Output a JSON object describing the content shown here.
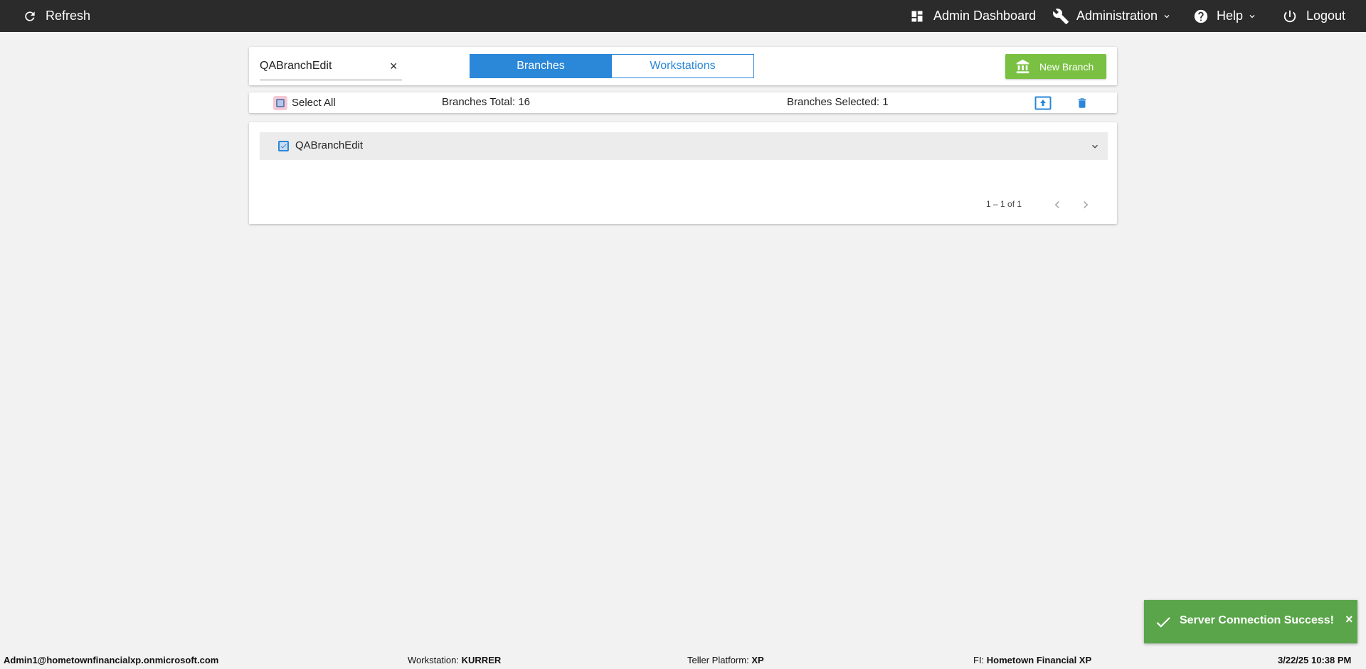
{
  "topbar": {
    "refresh_label": "Refresh",
    "admin_dashboard_label": "Admin Dashboard",
    "administration_label": "Administration",
    "help_label": "Help",
    "logout_label": "Logout"
  },
  "search": {
    "value": "QABranchEdit",
    "clear_symbol": "×"
  },
  "tabs": [
    {
      "label": "Branches",
      "active": true
    },
    {
      "label": "Workstations",
      "active": false
    }
  ],
  "new_branch_label": "New Branch",
  "summary": {
    "select_all_label": "Select All",
    "branches_total": "Branches Total: 16",
    "branches_selected": "Branches Selected: 1"
  },
  "list": {
    "items": [
      {
        "name": "QABranchEdit",
        "checked": true
      }
    ],
    "paginator": "1 – 1 of 1"
  },
  "toast": {
    "message": "Server Connection Success!",
    "close_symbol": "×"
  },
  "footer": {
    "user": "Admin1@hometownfinancialxp.onmicrosoft.com",
    "workstation_label": "Workstation:",
    "workstation_value": "KURRER",
    "platform_label": "Teller Platform:",
    "platform_value": "XP",
    "fi_label": "FI:",
    "fi_value": "Hometown Financial XP",
    "datetime": "3/22/25 10:38 PM"
  },
  "colors": {
    "topbar": "#2b2b2b",
    "accent_blue": "#2b87d8",
    "new_branch_green": "#7ac143",
    "toast_green": "#5aa54a",
    "background": "#f2f2f2"
  },
  "icons": [
    "refresh-icon",
    "dashboard-icon",
    "wrench-icon",
    "help-icon",
    "power-icon",
    "bank-icon",
    "upload-icon",
    "trash-icon",
    "chevron-down-icon",
    "chevron-left-icon",
    "chevron-right-icon",
    "checkmark-icon"
  ]
}
